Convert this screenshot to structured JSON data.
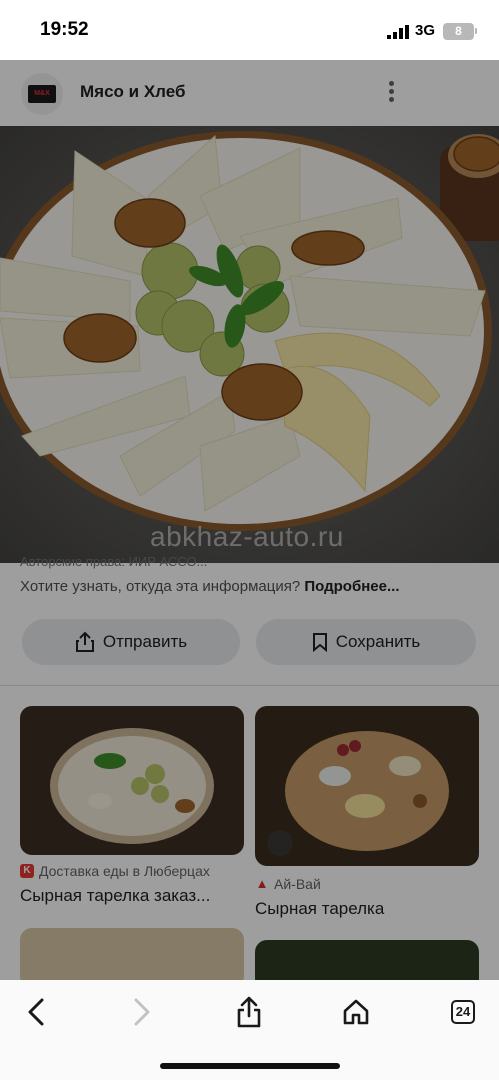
{
  "status_bar": {
    "time": "19:52",
    "network": "3G",
    "battery": "8"
  },
  "header": {
    "logo_text": "M&X",
    "title": "Мясо и Хлеб"
  },
  "hero": {
    "watermark": "abkhaz-auto.ru"
  },
  "info": {
    "copyright": "Авторские права: ИИР АССО...",
    "question": "Хотите узнать, откуда эта информация?",
    "more_link": "Подробнее..."
  },
  "actions": {
    "send_label": "Отправить",
    "save_label": "Сохранить"
  },
  "related": [
    {
      "source": "Доставка еды в Люберцах",
      "title": "Сырная тарелка заказ...",
      "icon_color": "#e53935",
      "icon_letter": "K"
    },
    {
      "source": "Ай-Вай",
      "title": "Сырная тарелка",
      "icon_color": "#d32f2f",
      "icon_letter": ""
    }
  ],
  "toolbar": {
    "tab_count": "24"
  },
  "colors": {
    "accent_bg": "#e8eaed",
    "text": "#202124",
    "muted": "#5f6368"
  }
}
